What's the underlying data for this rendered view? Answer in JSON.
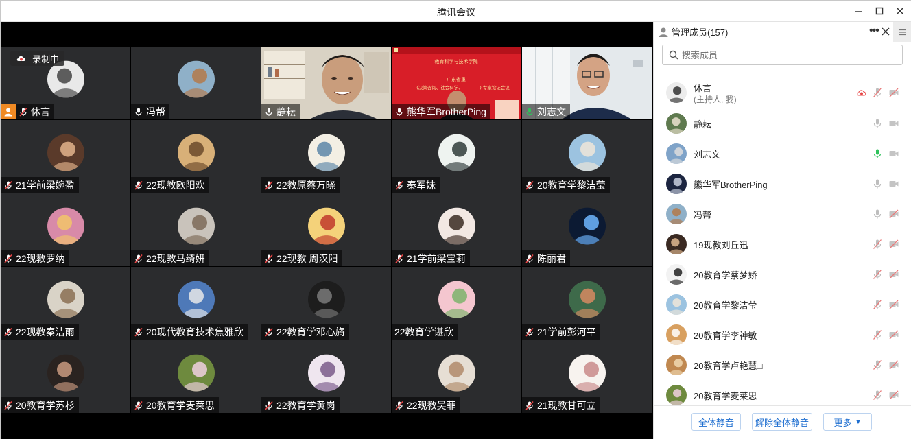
{
  "window": {
    "title": "腾讯会议"
  },
  "recording": {
    "label": "录制中"
  },
  "tiles": [
    {
      "name": "休言",
      "mic": "muted",
      "host": true,
      "kind": "avatar",
      "color": "#e9e9e9",
      "accent": "#444"
    },
    {
      "name": "冯帮",
      "mic": "on",
      "kind": "avatar",
      "color": "#8fb0c8",
      "accent": "#b47a4a"
    },
    {
      "name": "静耘",
      "mic": "on",
      "kind": "video",
      "scene": "office"
    },
    {
      "name": "熊华军BrotherPing",
      "mic": "on",
      "kind": "video",
      "scene": "slide",
      "slide": {
        "l1": "教育科学与技术学院",
        "l2": "广东省重",
        "l3": "(决策咨询、社会科学、",
        "l4": ") 专家论证会议"
      }
    },
    {
      "name": "刘志文",
      "mic": "speaking",
      "kind": "video",
      "scene": "man"
    },
    {
      "name": "21学前梁婉盈",
      "mic": "muted",
      "kind": "avatar",
      "color": "#5a3a2a",
      "accent": "#e3b48c"
    },
    {
      "name": "22现教欧阳欢",
      "mic": "muted",
      "kind": "avatar",
      "color": "#d8b078",
      "accent": "#6b4a2a"
    },
    {
      "name": "22教原蔡万晓",
      "mic": "muted",
      "kind": "avatar",
      "color": "#f3efe4",
      "accent": "#5c86a8"
    },
    {
      "name": "秦军妹",
      "mic": "muted",
      "kind": "avatar",
      "color": "#eef3f0",
      "accent": "#2f3b3a"
    },
    {
      "name": "20教育学黎洁莹",
      "mic": "muted",
      "kind": "avatar",
      "color": "#9cc3e0",
      "accent": "#f0e6d8"
    },
    {
      "name": "22现教罗纳",
      "mic": "muted",
      "kind": "avatar",
      "color": "#d88aa8",
      "accent": "#f2c46a"
    },
    {
      "name": "22现教马绮妍",
      "mic": "muted",
      "kind": "avatar",
      "color": "#c9c3bb",
      "accent": "#7d6a58"
    },
    {
      "name": "22现教 周汉阳",
      "mic": "muted",
      "kind": "avatar",
      "color": "#f4d27a",
      "accent": "#c0392b"
    },
    {
      "name": "21学前梁宝莉",
      "mic": "muted",
      "kind": "avatar",
      "color": "#f2e8e3",
      "accent": "#3a2a22"
    },
    {
      "name": "陈丽君",
      "mic": "muted",
      "kind": "avatar",
      "color": "#0c1a33",
      "accent": "#6fb6ff"
    },
    {
      "name": "22现教秦洁雨",
      "mic": "muted",
      "kind": "avatar",
      "color": "#d9d3c7",
      "accent": "#8a6f52"
    },
    {
      "name": "20现代教育技术焦雅欣",
      "mic": "muted",
      "kind": "avatar",
      "color": "#4e79b8",
      "accent": "#e8e8e8"
    },
    {
      "name": "22教育学邓心旖",
      "mic": "muted",
      "kind": "avatar",
      "color": "#1d1d1d",
      "accent": "#7a7a7a"
    },
    {
      "name": "22教育学谌欣",
      "mic": "none",
      "kind": "avatar",
      "color": "#f4c6cf",
      "accent": "#7bb36b"
    },
    {
      "name": "21学前彭河平",
      "mic": "muted",
      "kind": "avatar",
      "color": "#3e6a4a",
      "accent": "#d78a62"
    },
    {
      "name": "20教育学苏杉",
      "mic": "muted",
      "kind": "avatar",
      "color": "#2a2320",
      "accent": "#c99a80"
    },
    {
      "name": "20教育学麦莱思",
      "mic": "muted",
      "kind": "avatar",
      "color": "#6e8a3e",
      "accent": "#f0d0e0"
    },
    {
      "name": "22教育学黄岗",
      "mic": "muted",
      "kind": "avatar",
      "color": "#efe6ef",
      "accent": "#7a5a8a"
    },
    {
      "name": "22现教吴菲",
      "mic": "muted",
      "kind": "avatar",
      "color": "#e6ded4",
      "accent": "#b08a6a"
    },
    {
      "name": "21现教甘可立",
      "mic": "muted",
      "kind": "avatar",
      "color": "#f7f3ef",
      "accent": "#c98a8a"
    }
  ],
  "panel": {
    "title": "管理成员(157)",
    "search_placeholder": "搜索成员",
    "members": [
      {
        "name": "休言",
        "sub": "(主持人, 我)",
        "mic": "muted-red",
        "cam": "off",
        "color": "#ececec",
        "accent": "#333",
        "rec": true
      },
      {
        "name": "静耘",
        "mic": "on",
        "cam": "on",
        "color": "#5f7a4f",
        "accent": "#ece3d0"
      },
      {
        "name": "刘志文",
        "mic": "speaking",
        "cam": "on",
        "color": "#7fa3c8",
        "accent": "#ddd"
      },
      {
        "name": "熊华军BrotherPing",
        "mic": "on",
        "cam": "on",
        "color": "#1c2540",
        "accent": "#c9d0e0"
      },
      {
        "name": "冯帮",
        "mic": "on",
        "cam": "off",
        "color": "#8fb0c8",
        "accent": "#b47a4a"
      },
      {
        "name": "19现教刘丘迅",
        "mic": "muted",
        "cam": "off",
        "color": "#3a2a22",
        "accent": "#e0b890"
      },
      {
        "name": "20教育学蔡梦娇",
        "mic": "muted",
        "cam": "off",
        "color": "#f2f2f2",
        "accent": "#222"
      },
      {
        "name": "20教育学黎洁莹",
        "mic": "muted",
        "cam": "off",
        "color": "#9cc3e0",
        "accent": "#f0e6d8"
      },
      {
        "name": "20教育学李神敏",
        "mic": "muted",
        "cam": "off",
        "color": "#d8a060",
        "accent": "#fff"
      },
      {
        "name": "20教育学卢艳慧□",
        "mic": "muted",
        "cam": "off",
        "color": "#c08850",
        "accent": "#f0d8b0"
      },
      {
        "name": "20教育学麦莱思",
        "mic": "muted",
        "cam": "off",
        "color": "#6e8a3e",
        "accent": "#f0d0e0"
      }
    ],
    "buttons": {
      "mute_all": "全体静音",
      "unmute_all": "解除全体静音",
      "more": "更多"
    }
  }
}
